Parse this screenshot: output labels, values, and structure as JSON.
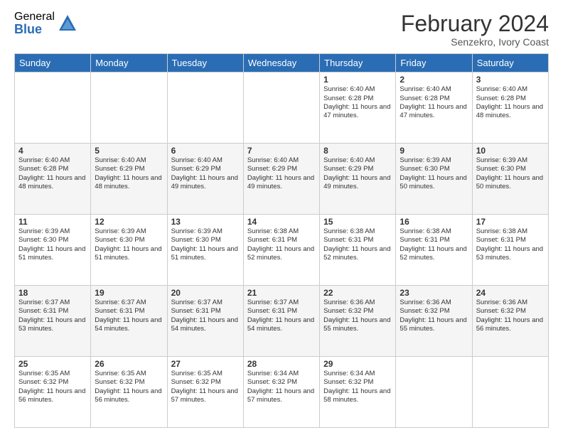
{
  "logo": {
    "general": "General",
    "blue": "Blue"
  },
  "title": "February 2024",
  "subtitle": "Senzekro, Ivory Coast",
  "days": [
    "Sunday",
    "Monday",
    "Tuesday",
    "Wednesday",
    "Thursday",
    "Friday",
    "Saturday"
  ],
  "weeks": [
    [
      {
        "day": "",
        "info": ""
      },
      {
        "day": "",
        "info": ""
      },
      {
        "day": "",
        "info": ""
      },
      {
        "day": "",
        "info": ""
      },
      {
        "day": "1",
        "info": "Sunrise: 6:40 AM\nSunset: 6:28 PM\nDaylight: 11 hours and 47 minutes."
      },
      {
        "day": "2",
        "info": "Sunrise: 6:40 AM\nSunset: 6:28 PM\nDaylight: 11 hours and 47 minutes."
      },
      {
        "day": "3",
        "info": "Sunrise: 6:40 AM\nSunset: 6:28 PM\nDaylight: 11 hours and 48 minutes."
      }
    ],
    [
      {
        "day": "4",
        "info": "Sunrise: 6:40 AM\nSunset: 6:28 PM\nDaylight: 11 hours and 48 minutes."
      },
      {
        "day": "5",
        "info": "Sunrise: 6:40 AM\nSunset: 6:29 PM\nDaylight: 11 hours and 48 minutes."
      },
      {
        "day": "6",
        "info": "Sunrise: 6:40 AM\nSunset: 6:29 PM\nDaylight: 11 hours and 49 minutes."
      },
      {
        "day": "7",
        "info": "Sunrise: 6:40 AM\nSunset: 6:29 PM\nDaylight: 11 hours and 49 minutes."
      },
      {
        "day": "8",
        "info": "Sunrise: 6:40 AM\nSunset: 6:29 PM\nDaylight: 11 hours and 49 minutes."
      },
      {
        "day": "9",
        "info": "Sunrise: 6:39 AM\nSunset: 6:30 PM\nDaylight: 11 hours and 50 minutes."
      },
      {
        "day": "10",
        "info": "Sunrise: 6:39 AM\nSunset: 6:30 PM\nDaylight: 11 hours and 50 minutes."
      }
    ],
    [
      {
        "day": "11",
        "info": "Sunrise: 6:39 AM\nSunset: 6:30 PM\nDaylight: 11 hours and 51 minutes."
      },
      {
        "day": "12",
        "info": "Sunrise: 6:39 AM\nSunset: 6:30 PM\nDaylight: 11 hours and 51 minutes."
      },
      {
        "day": "13",
        "info": "Sunrise: 6:39 AM\nSunset: 6:30 PM\nDaylight: 11 hours and 51 minutes."
      },
      {
        "day": "14",
        "info": "Sunrise: 6:38 AM\nSunset: 6:31 PM\nDaylight: 11 hours and 52 minutes."
      },
      {
        "day": "15",
        "info": "Sunrise: 6:38 AM\nSunset: 6:31 PM\nDaylight: 11 hours and 52 minutes."
      },
      {
        "day": "16",
        "info": "Sunrise: 6:38 AM\nSunset: 6:31 PM\nDaylight: 11 hours and 52 minutes."
      },
      {
        "day": "17",
        "info": "Sunrise: 6:38 AM\nSunset: 6:31 PM\nDaylight: 11 hours and 53 minutes."
      }
    ],
    [
      {
        "day": "18",
        "info": "Sunrise: 6:37 AM\nSunset: 6:31 PM\nDaylight: 11 hours and 53 minutes."
      },
      {
        "day": "19",
        "info": "Sunrise: 6:37 AM\nSunset: 6:31 PM\nDaylight: 11 hours and 54 minutes."
      },
      {
        "day": "20",
        "info": "Sunrise: 6:37 AM\nSunset: 6:31 PM\nDaylight: 11 hours and 54 minutes."
      },
      {
        "day": "21",
        "info": "Sunrise: 6:37 AM\nSunset: 6:31 PM\nDaylight: 11 hours and 54 minutes."
      },
      {
        "day": "22",
        "info": "Sunrise: 6:36 AM\nSunset: 6:32 PM\nDaylight: 11 hours and 55 minutes."
      },
      {
        "day": "23",
        "info": "Sunrise: 6:36 AM\nSunset: 6:32 PM\nDaylight: 11 hours and 55 minutes."
      },
      {
        "day": "24",
        "info": "Sunrise: 6:36 AM\nSunset: 6:32 PM\nDaylight: 11 hours and 56 minutes."
      }
    ],
    [
      {
        "day": "25",
        "info": "Sunrise: 6:35 AM\nSunset: 6:32 PM\nDaylight: 11 hours and 56 minutes."
      },
      {
        "day": "26",
        "info": "Sunrise: 6:35 AM\nSunset: 6:32 PM\nDaylight: 11 hours and 56 minutes."
      },
      {
        "day": "27",
        "info": "Sunrise: 6:35 AM\nSunset: 6:32 PM\nDaylight: 11 hours and 57 minutes."
      },
      {
        "day": "28",
        "info": "Sunrise: 6:34 AM\nSunset: 6:32 PM\nDaylight: 11 hours and 57 minutes."
      },
      {
        "day": "29",
        "info": "Sunrise: 6:34 AM\nSunset: 6:32 PM\nDaylight: 11 hours and 58 minutes."
      },
      {
        "day": "",
        "info": ""
      },
      {
        "day": "",
        "info": ""
      }
    ]
  ]
}
